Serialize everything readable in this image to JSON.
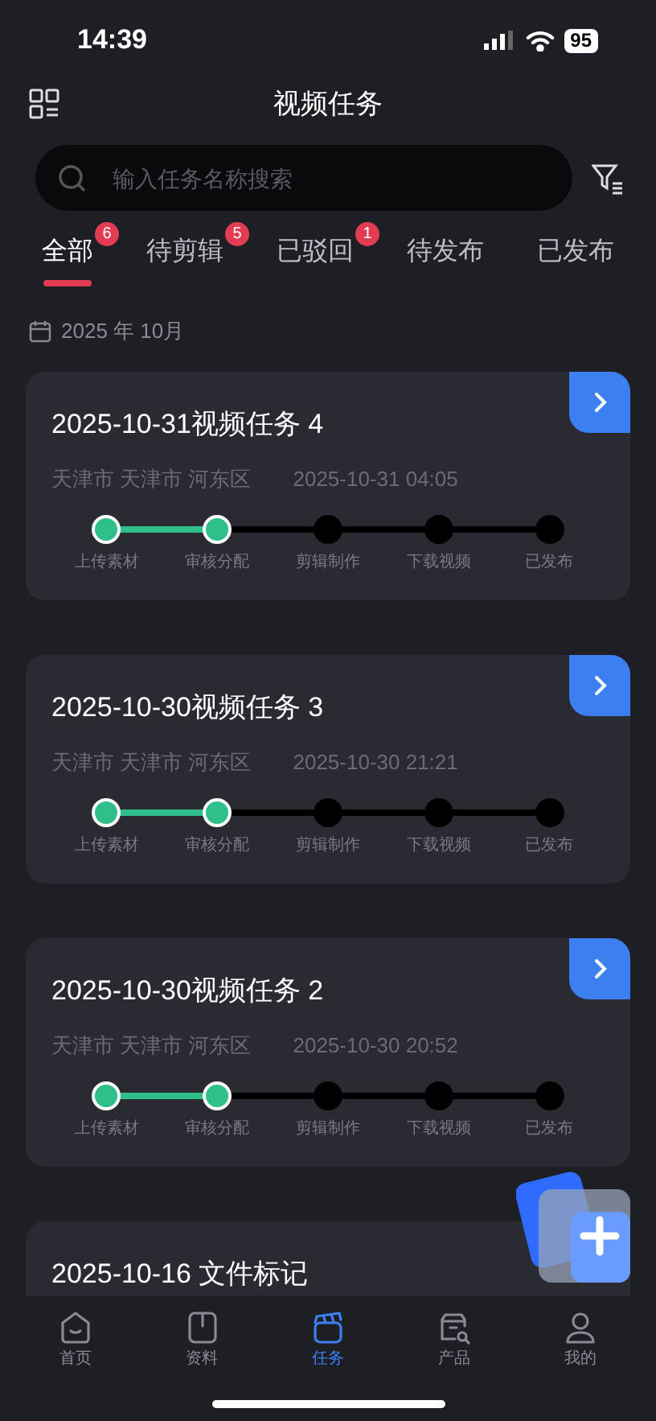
{
  "status_bar": {
    "time": "14:39",
    "battery": "95"
  },
  "header": {
    "title": "视频任务"
  },
  "search": {
    "placeholder": "输入任务名称搜索"
  },
  "tabs": [
    {
      "label": "全部",
      "badge": "6",
      "selected": true
    },
    {
      "label": "待剪辑",
      "badge": "5",
      "selected": false
    },
    {
      "label": "已驳回",
      "badge": "1",
      "selected": false
    },
    {
      "label": "待发布",
      "selected": false
    },
    {
      "label": "已发布",
      "selected": false
    }
  ],
  "month": "2025 年 10月",
  "tasks": [
    {
      "title": "2025-10-31视频任务 4",
      "location": "天津市 天津市 河东区",
      "time": "2025-10-31 04:05",
      "steps": [
        {
          "label": "上传素材",
          "done": true
        },
        {
          "label": "审核分配",
          "done": true
        },
        {
          "label": "剪辑制作",
          "done": false
        },
        {
          "label": "下载视频",
          "done": false
        },
        {
          "label": "已发布",
          "done": false
        }
      ]
    },
    {
      "title": "2025-10-30视频任务 3",
      "location": "天津市 天津市 河东区",
      "time": "2025-10-30 21:21",
      "steps": [
        {
          "label": "上传素材",
          "done": true
        },
        {
          "label": "审核分配",
          "done": true
        },
        {
          "label": "剪辑制作",
          "done": false
        },
        {
          "label": "下载视频",
          "done": false
        },
        {
          "label": "已发布",
          "done": false
        }
      ]
    },
    {
      "title": "2025-10-30视频任务 2",
      "location": "天津市 天津市 河东区",
      "time": "2025-10-30 20:52",
      "steps": [
        {
          "label": "上传素材",
          "done": true
        },
        {
          "label": "审核分配",
          "done": true
        },
        {
          "label": "剪辑制作",
          "done": false
        },
        {
          "label": "下载视频",
          "done": false
        },
        {
          "label": "已发布",
          "done": false
        }
      ]
    },
    {
      "title": "2025-10-16 文件标记"
    }
  ],
  "nav": [
    {
      "label": "首页",
      "kind": "home",
      "selected": false
    },
    {
      "label": "资料",
      "kind": "book",
      "selected": false
    },
    {
      "label": "任务",
      "kind": "clapper",
      "selected": true
    },
    {
      "label": "产品",
      "kind": "box",
      "selected": false
    },
    {
      "label": "我的",
      "kind": "user",
      "selected": false
    }
  ]
}
